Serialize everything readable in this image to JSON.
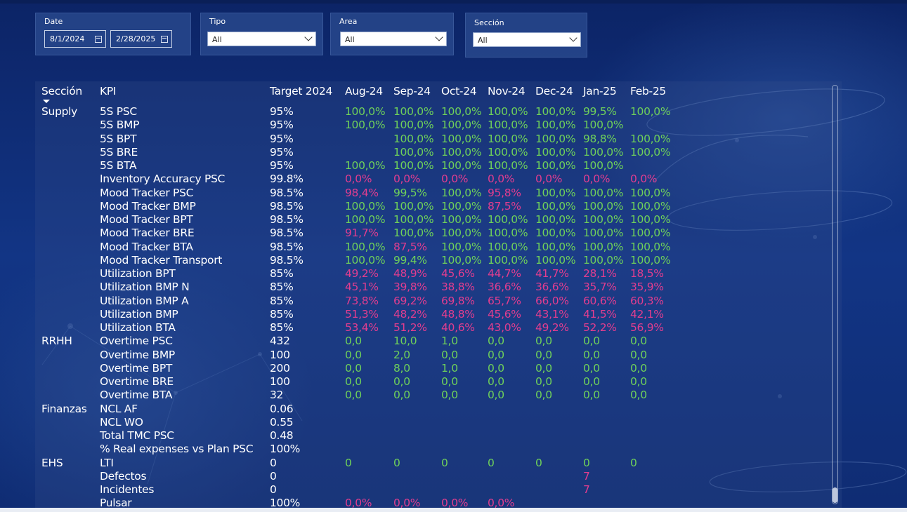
{
  "colors": {
    "good": "#6fd15a",
    "bad": "#e23d8f",
    "bg": "#0e2a73"
  },
  "filters": {
    "date": {
      "label": "Date",
      "start": "8/1/2024",
      "end": "2/28/2025",
      "icon": "calendar-icon"
    },
    "tipo": {
      "label": "Tipo",
      "value": "All"
    },
    "area": {
      "label": "Area",
      "value": "All"
    },
    "seccion": {
      "label": "Sección",
      "value": "All"
    }
  },
  "table": {
    "headers": [
      "Sección",
      "KPI",
      "Target 2024",
      "Aug-24",
      "Sep-24",
      "Oct-24",
      "Nov-24",
      "Dec-24",
      "Jan-25",
      "Feb-25"
    ],
    "rows": [
      {
        "seccion": "Supply",
        "kpi": "5S PSC",
        "target": "95%",
        "values": [
          "100,0%",
          "100,0%",
          "100,0%",
          "100,0%",
          "100,0%",
          "99,5%",
          "100,0%"
        ],
        "status": [
          "g",
          "g",
          "g",
          "g",
          "g",
          "g",
          "g"
        ]
      },
      {
        "seccion": "",
        "kpi": "5S BMP",
        "target": "95%",
        "values": [
          "100,0%",
          "100,0%",
          "100,0%",
          "100,0%",
          "100,0%",
          "100,0%",
          ""
        ],
        "status": [
          "g",
          "g",
          "g",
          "g",
          "g",
          "g",
          ""
        ]
      },
      {
        "seccion": "",
        "kpi": "5S BPT",
        "target": "95%",
        "values": [
          "",
          "100,0%",
          "100,0%",
          "100,0%",
          "100,0%",
          "98,8%",
          "100,0%"
        ],
        "status": [
          "",
          "g",
          "g",
          "g",
          "g",
          "g",
          "g"
        ]
      },
      {
        "seccion": "",
        "kpi": "5S BRE",
        "target": "95%",
        "values": [
          "",
          "100,0%",
          "100,0%",
          "100,0%",
          "100,0%",
          "100,0%",
          "100,0%"
        ],
        "status": [
          "",
          "g",
          "g",
          "g",
          "g",
          "g",
          "g"
        ]
      },
      {
        "seccion": "",
        "kpi": "5S BTA",
        "target": "95%",
        "values": [
          "100,0%",
          "100,0%",
          "100,0%",
          "100,0%",
          "100,0%",
          "100,0%",
          ""
        ],
        "status": [
          "g",
          "g",
          "g",
          "g",
          "g",
          "g",
          ""
        ]
      },
      {
        "seccion": "",
        "kpi": "Inventory Accuracy PSC",
        "target": "99.8%",
        "values": [
          "0,0%",
          "0,0%",
          "0,0%",
          "0,0%",
          "0,0%",
          "0,0%",
          "0,0%"
        ],
        "status": [
          "b",
          "b",
          "b",
          "b",
          "b",
          "b",
          "b"
        ]
      },
      {
        "seccion": "",
        "kpi": "Mood Tracker PSC",
        "target": "98.5%",
        "values": [
          "98,4%",
          "99,5%",
          "100,0%",
          "95,8%",
          "100,0%",
          "100,0%",
          "100,0%"
        ],
        "status": [
          "b",
          "g",
          "g",
          "b",
          "g",
          "g",
          "g"
        ]
      },
      {
        "seccion": "",
        "kpi": "Mood Tracker BMP",
        "target": "98.5%",
        "values": [
          "100,0%",
          "100,0%",
          "100,0%",
          "87,5%",
          "100,0%",
          "100,0%",
          "100,0%"
        ],
        "status": [
          "g",
          "g",
          "g",
          "b",
          "g",
          "g",
          "g"
        ]
      },
      {
        "seccion": "",
        "kpi": "Mood Tracker BPT",
        "target": "98.5%",
        "values": [
          "100,0%",
          "100,0%",
          "100,0%",
          "100,0%",
          "100,0%",
          "100,0%",
          "100,0%"
        ],
        "status": [
          "g",
          "g",
          "g",
          "g",
          "g",
          "g",
          "g"
        ]
      },
      {
        "seccion": "",
        "kpi": "Mood Tracker BRE",
        "target": "98.5%",
        "values": [
          "91,7%",
          "100,0%",
          "100,0%",
          "100,0%",
          "100,0%",
          "100,0%",
          "100,0%"
        ],
        "status": [
          "b",
          "g",
          "g",
          "g",
          "g",
          "g",
          "g"
        ]
      },
      {
        "seccion": "",
        "kpi": "Mood Tracker BTA",
        "target": "98.5%",
        "values": [
          "100,0%",
          "87,5%",
          "100,0%",
          "100,0%",
          "100,0%",
          "100,0%",
          "100,0%"
        ],
        "status": [
          "g",
          "b",
          "g",
          "g",
          "g",
          "g",
          "g"
        ]
      },
      {
        "seccion": "",
        "kpi": "Mood Tracker Transport",
        "target": "98.5%",
        "values": [
          "100,0%",
          "99,4%",
          "100,0%",
          "100,0%",
          "100,0%",
          "100,0%",
          "100,0%"
        ],
        "status": [
          "g",
          "g",
          "g",
          "g",
          "g",
          "g",
          "g"
        ]
      },
      {
        "seccion": "",
        "kpi": "Utilization BPT",
        "target": "85%",
        "values": [
          "49,2%",
          "48,9%",
          "45,6%",
          "44,7%",
          "41,7%",
          "28,1%",
          "18,5%"
        ],
        "status": [
          "b",
          "b",
          "b",
          "b",
          "b",
          "b",
          "b"
        ]
      },
      {
        "seccion": "",
        "kpi": "Utilization BMP N",
        "target": "85%",
        "values": [
          "45,1%",
          "39,8%",
          "38,8%",
          "36,6%",
          "36,6%",
          "35,7%",
          "35,9%"
        ],
        "status": [
          "b",
          "b",
          "b",
          "b",
          "b",
          "b",
          "b"
        ]
      },
      {
        "seccion": "",
        "kpi": "Utilization BMP A",
        "target": "85%",
        "values": [
          "73,8%",
          "69,2%",
          "69,8%",
          "65,7%",
          "66,0%",
          "60,6%",
          "60,3%"
        ],
        "status": [
          "b",
          "b",
          "b",
          "b",
          "b",
          "b",
          "b"
        ]
      },
      {
        "seccion": "",
        "kpi": "Utilization BMP",
        "target": "85%",
        "values": [
          "51,3%",
          "48,2%",
          "48,8%",
          "45,6%",
          "43,1%",
          "41,5%",
          "42,1%"
        ],
        "status": [
          "b",
          "b",
          "b",
          "b",
          "b",
          "b",
          "b"
        ]
      },
      {
        "seccion": "",
        "kpi": "Utilization BTA",
        "target": "85%",
        "values": [
          "53,4%",
          "51,2%",
          "40,6%",
          "43,0%",
          "49,2%",
          "52,2%",
          "56,9%"
        ],
        "status": [
          "b",
          "b",
          "b",
          "b",
          "b",
          "b",
          "b"
        ]
      },
      {
        "seccion": "RRHH",
        "kpi": "Overtime PSC",
        "target": "432",
        "values": [
          "0,0",
          "10,0",
          "1,0",
          "0,0",
          "0,0",
          "0,0",
          "0,0"
        ],
        "status": [
          "g",
          "g",
          "g",
          "g",
          "g",
          "g",
          "g"
        ]
      },
      {
        "seccion": "",
        "kpi": "Overtime BMP",
        "target": "100",
        "values": [
          "0,0",
          "2,0",
          "0,0",
          "0,0",
          "0,0",
          "0,0",
          "0,0"
        ],
        "status": [
          "g",
          "g",
          "g",
          "g",
          "g",
          "g",
          "g"
        ]
      },
      {
        "seccion": "",
        "kpi": "Overtime BPT",
        "target": "200",
        "values": [
          "0,0",
          "8,0",
          "1,0",
          "0,0",
          "0,0",
          "0,0",
          "0,0"
        ],
        "status": [
          "g",
          "g",
          "g",
          "g",
          "g",
          "g",
          "g"
        ]
      },
      {
        "seccion": "",
        "kpi": "Overtime BRE",
        "target": "100",
        "values": [
          "0,0",
          "0,0",
          "0,0",
          "0,0",
          "0,0",
          "0,0",
          "0,0"
        ],
        "status": [
          "g",
          "g",
          "g",
          "g",
          "g",
          "g",
          "g"
        ]
      },
      {
        "seccion": "",
        "kpi": "Overtime BTA",
        "target": "32",
        "values": [
          "0,0",
          "0,0",
          "0,0",
          "0,0",
          "0,0",
          "0,0",
          "0,0"
        ],
        "status": [
          "g",
          "g",
          "g",
          "g",
          "g",
          "g",
          "g"
        ]
      },
      {
        "seccion": "Finanzas",
        "kpi": "NCL AF",
        "target": "0.06",
        "values": [
          "",
          "",
          "",
          "",
          "",
          "",
          ""
        ],
        "status": [
          "",
          "",
          "",
          "",
          "",
          "",
          ""
        ]
      },
      {
        "seccion": "",
        "kpi": "NCL WO",
        "target": "0.55",
        "values": [
          "",
          "",
          "",
          "",
          "",
          "",
          ""
        ],
        "status": [
          "",
          "",
          "",
          "",
          "",
          "",
          ""
        ]
      },
      {
        "seccion": "",
        "kpi": "Total TMC PSC",
        "target": "0.48",
        "values": [
          "",
          "",
          "",
          "",
          "",
          "",
          ""
        ],
        "status": [
          "",
          "",
          "",
          "",
          "",
          "",
          ""
        ]
      },
      {
        "seccion": "",
        "kpi": "% Real expenses vs Plan PSC",
        "target": "100%",
        "values": [
          "",
          "",
          "",
          "",
          "",
          "",
          ""
        ],
        "status": [
          "",
          "",
          "",
          "",
          "",
          "",
          ""
        ]
      },
      {
        "seccion": "EHS",
        "kpi": "LTI",
        "target": "0",
        "values": [
          "0",
          "0",
          "0",
          "0",
          "0",
          "0",
          "0"
        ],
        "status": [
          "g",
          "g",
          "g",
          "g",
          "g",
          "g",
          "g"
        ]
      },
      {
        "seccion": "",
        "kpi": "Defectos",
        "target": "0",
        "values": [
          "",
          "",
          "",
          "",
          "",
          "7",
          ""
        ],
        "status": [
          "",
          "",
          "",
          "",
          "",
          "b",
          ""
        ]
      },
      {
        "seccion": "",
        "kpi": "Incidentes",
        "target": "0",
        "values": [
          "",
          "",
          "",
          "",
          "",
          "7",
          ""
        ],
        "status": [
          "",
          "",
          "",
          "",
          "",
          "b",
          ""
        ]
      },
      {
        "seccion": "",
        "kpi": "Pulsar",
        "target": "100%",
        "values": [
          "0,0%",
          "0,0%",
          "0,0%",
          "0,0%",
          "",
          "",
          ""
        ],
        "status": [
          "b",
          "b",
          "b",
          "b",
          "",
          "",
          ""
        ]
      }
    ]
  }
}
